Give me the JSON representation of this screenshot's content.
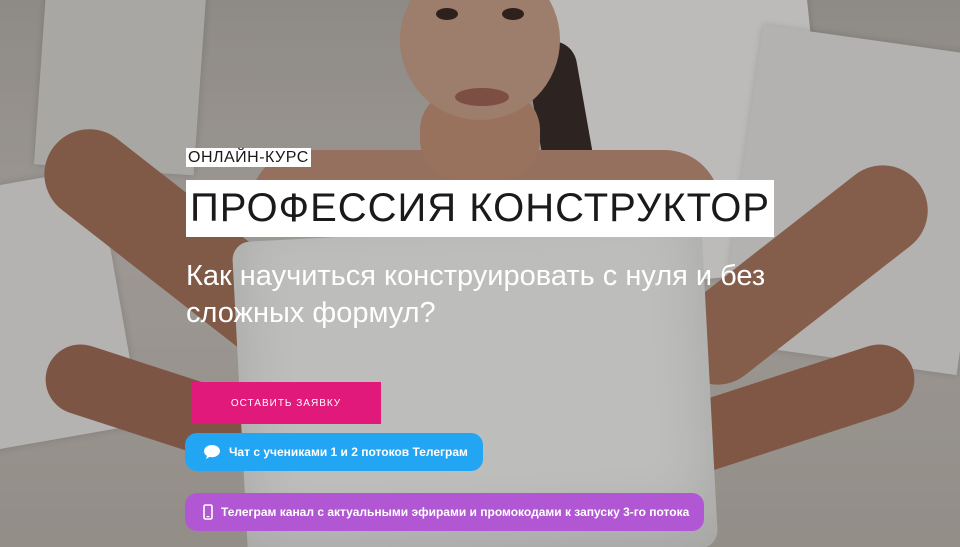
{
  "hero": {
    "overline": "ОНЛАЙН-КУРС",
    "title": "ПРОФЕССИЯ КОНСТРУКТОР",
    "subtitle": "Как научиться конструировать с нуля и без сложных формул?",
    "apply_button": "ОСТАВИТЬ ЗАЯВКУ",
    "links": [
      {
        "label": "Чат с учениками 1 и 2 потоков Телеграм",
        "icon": "chat-bubble-icon",
        "color": "#22a6f4"
      },
      {
        "label": "Телеграм канал с актуальными эфирами и промокодами к запуску 3-го потока",
        "icon": "phone-icon",
        "color": "#b257d3"
      }
    ]
  },
  "colors": {
    "accent": "#e0197a",
    "chat": "#22a6f4",
    "channel": "#b257d3"
  }
}
